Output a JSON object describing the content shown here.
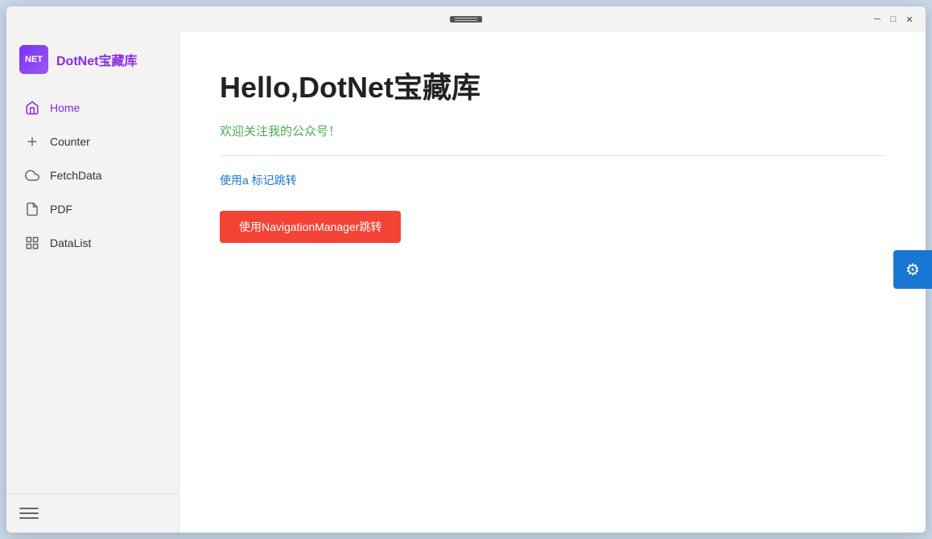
{
  "window": {
    "title": "DotNet宝藏库"
  },
  "titleBar": {
    "hamburgerLabel": "menu",
    "minimizeLabel": "─",
    "maximizeLabel": "□",
    "closeLabel": "✕"
  },
  "sidebar": {
    "logoText": "NET",
    "appTitle": "DotNet宝藏库",
    "navItems": [
      {
        "id": "home",
        "label": "Home",
        "icon": "home",
        "active": true
      },
      {
        "id": "counter",
        "label": "Counter",
        "icon": "plus",
        "active": false
      },
      {
        "id": "fetchdata",
        "label": "FetchData",
        "icon": "cloud",
        "active": false
      },
      {
        "id": "pdf",
        "label": "PDF",
        "icon": "doc",
        "active": false
      },
      {
        "id": "datalist",
        "label": "DataList",
        "icon": "grid",
        "active": false
      }
    ],
    "menuToggleLabel": "toggle menu"
  },
  "main": {
    "pageTitle": "Hello,DotNet宝藏库",
    "welcomeText": "欢迎关注我的公众号！",
    "linkText": "使用a 标记跳转",
    "navButtonText": "使用NavigationManager跳转"
  },
  "gearButton": {
    "icon": "⚙",
    "label": "settings"
  }
}
